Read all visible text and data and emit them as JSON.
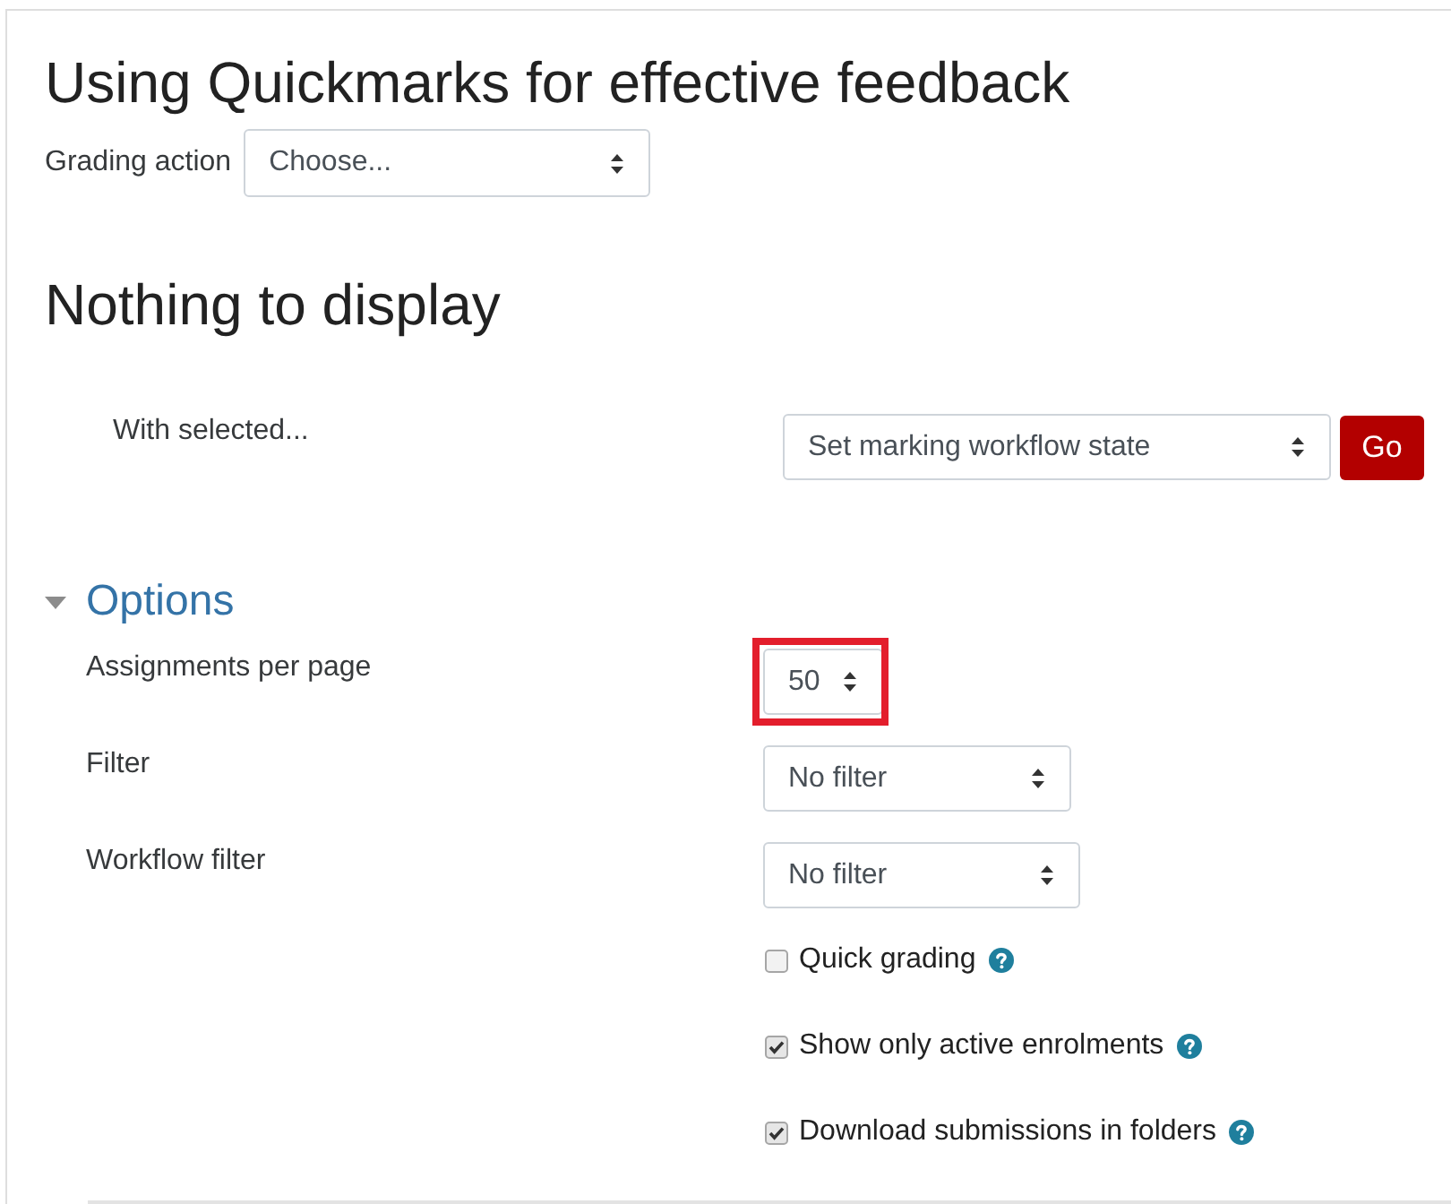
{
  "page": {
    "title": "Using Quickmarks for effective feedback"
  },
  "grading_action": {
    "label": "Grading action",
    "value": "Choose..."
  },
  "empty_heading": "Nothing to display",
  "bulk_action": {
    "label": "With selected...",
    "value": "Set marking workflow state",
    "button": "Go"
  },
  "options": {
    "title": "Options",
    "expanded": true,
    "fields": [
      {
        "kind": "select",
        "label": "Assignments per page",
        "value": "50",
        "highlighted": true
      },
      {
        "kind": "select",
        "label": "Filter",
        "value": "No filter",
        "highlighted": false
      },
      {
        "kind": "select",
        "label": "Workflow filter",
        "value": "No filter",
        "highlighted": false
      },
      {
        "kind": "checkbox",
        "label": "Quick grading",
        "checked": false,
        "help": true
      },
      {
        "kind": "checkbox",
        "label": "Show only active enrolments",
        "checked": true,
        "help": true
      },
      {
        "kind": "checkbox",
        "label": "Download submissions in folders",
        "checked": true,
        "help": true
      }
    ]
  }
}
